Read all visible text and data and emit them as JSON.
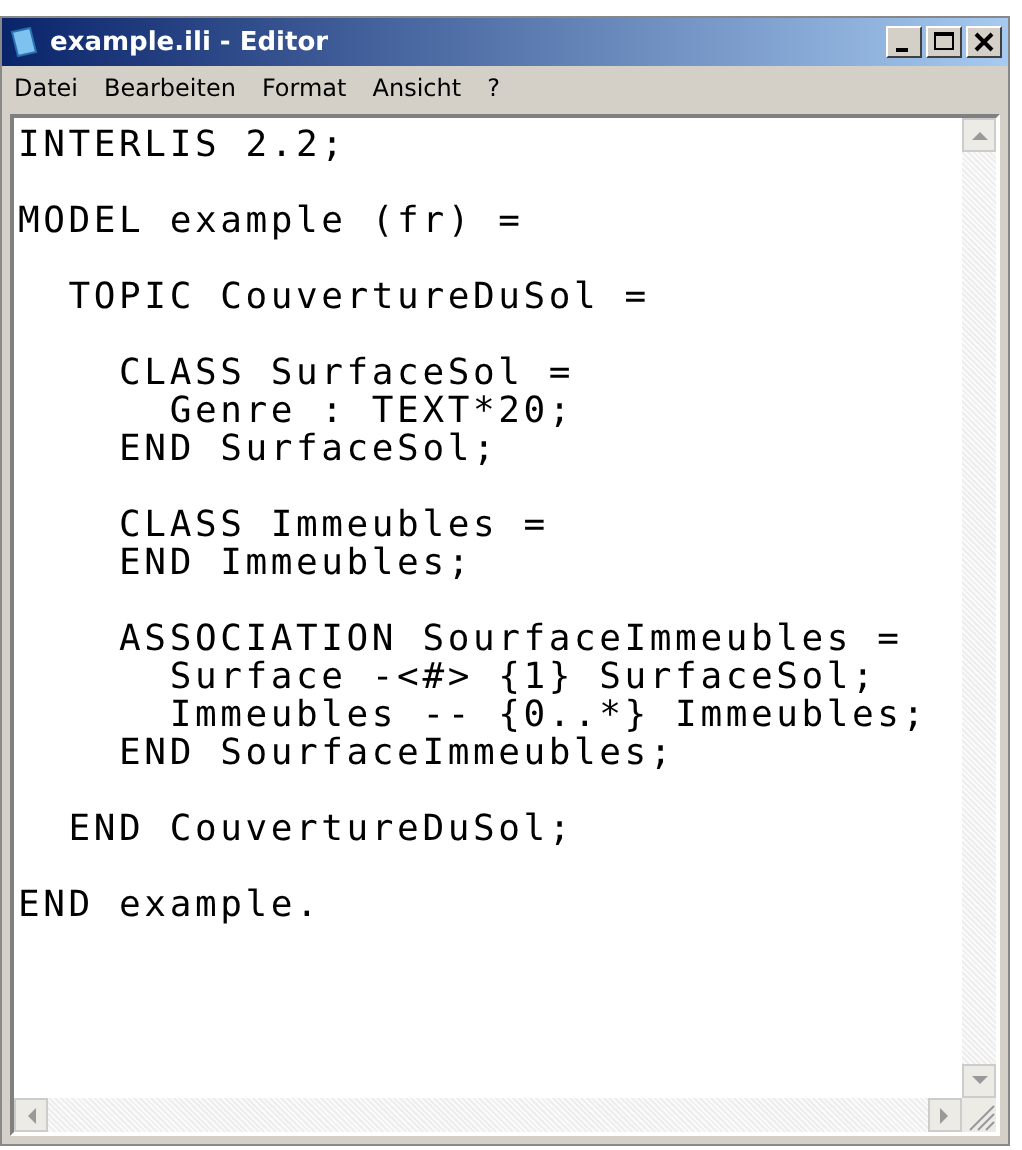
{
  "window": {
    "title": "example.ili - Editor"
  },
  "menu": [
    "Datei",
    "Bearbeiten",
    "Format",
    "Ansicht",
    "?"
  ],
  "editor": {
    "text": "INTERLIS 2.2;\n\nMODEL example (fr) =\n\n  TOPIC CouvertureDuSol =\n\n    CLASS SurfaceSol =\n      Genre : TEXT*20;\n    END SurfaceSol;\n\n    CLASS Immeubles =\n    END Immeubles;\n\n    ASSOCIATION SourfaceImmeubles =\n      Surface -<#> {1} SurfaceSol;\n      Immeubles -- {0..*} Immeubles;\n    END SourfaceImmeubles;\n\n  END CouvertureDuSol;\n\nEND example."
  }
}
